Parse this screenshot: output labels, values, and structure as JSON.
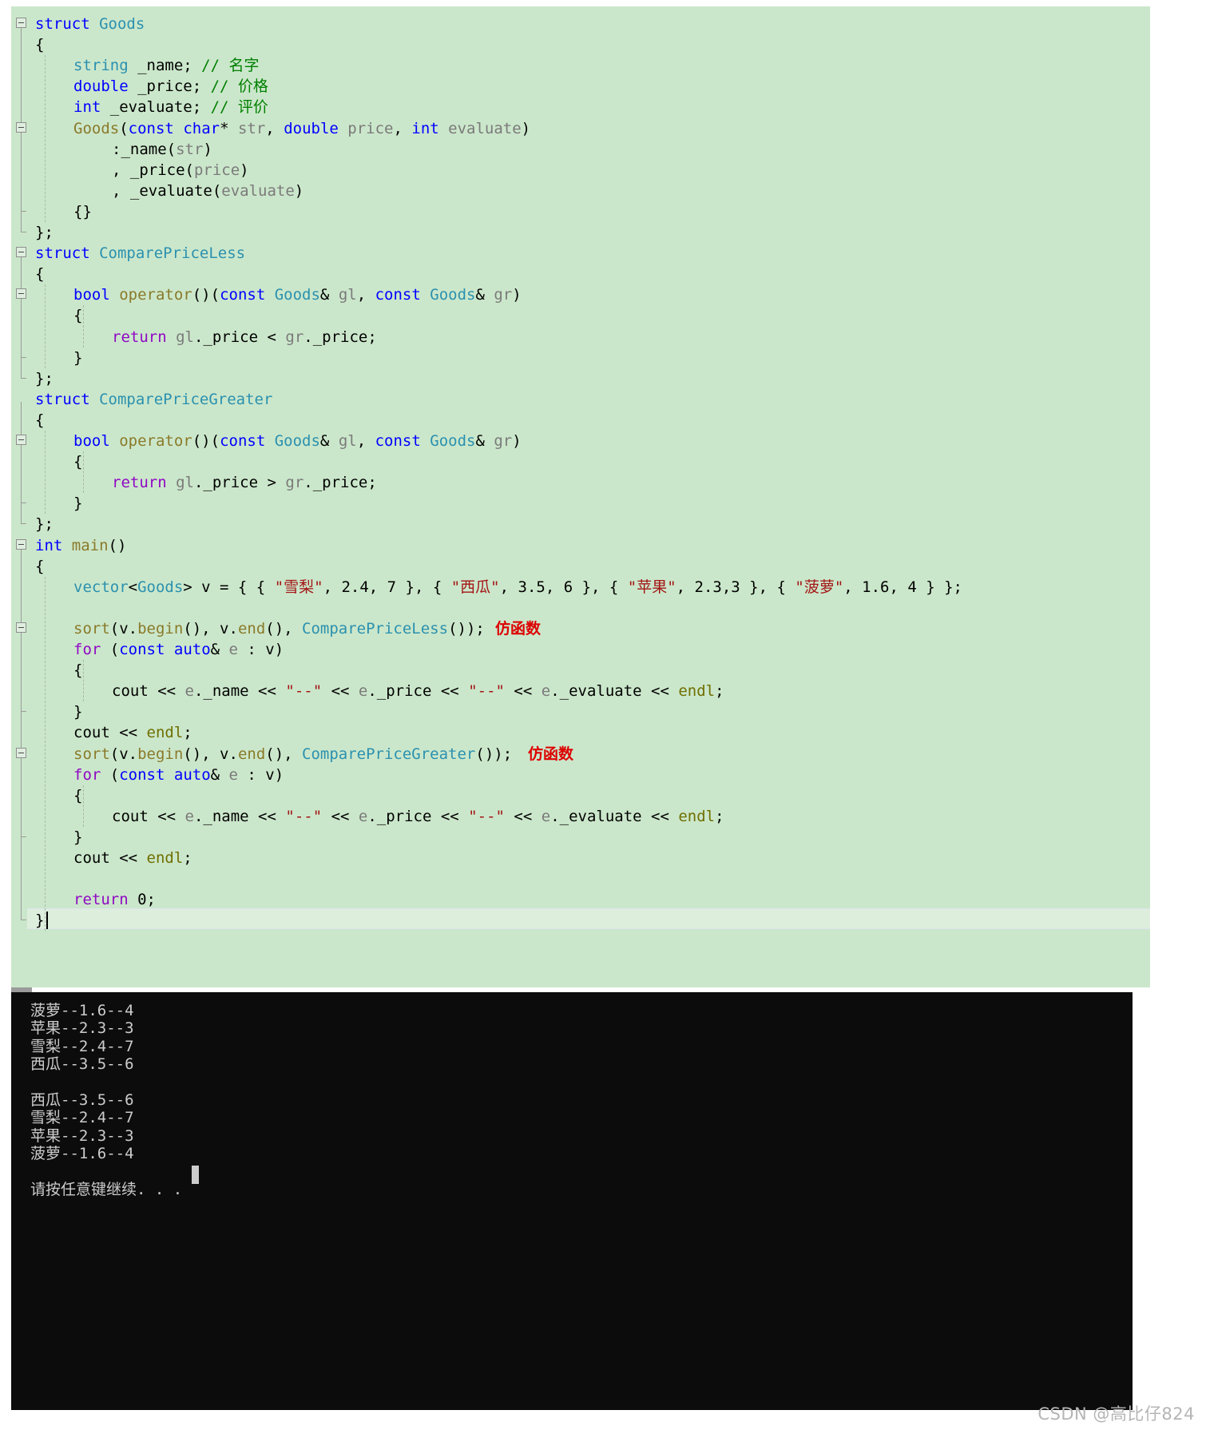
{
  "editor": {
    "background_color": "#cbe7cb",
    "current_line_color": "#ddeedd",
    "lines": [
      {
        "indent": 0,
        "tokens": [
          {
            "t": "struct ",
            "c": "kw"
          },
          {
            "t": "Goods",
            "c": "type"
          }
        ]
      },
      {
        "indent": 0,
        "tokens": [
          {
            "t": "{",
            "c": "plain"
          }
        ]
      },
      {
        "indent": 1,
        "tokens": [
          {
            "t": "string",
            "c": "type"
          },
          {
            "t": " _name; ",
            "c": "plain"
          },
          {
            "t": "// 名字",
            "c": "cmt"
          }
        ]
      },
      {
        "indent": 1,
        "tokens": [
          {
            "t": "double",
            "c": "kw"
          },
          {
            "t": " _price; ",
            "c": "plain"
          },
          {
            "t": "// 价格",
            "c": "cmt"
          }
        ]
      },
      {
        "indent": 1,
        "tokens": [
          {
            "t": "int",
            "c": "kw"
          },
          {
            "t": " _evaluate; ",
            "c": "plain"
          },
          {
            "t": "// 评价",
            "c": "cmt"
          }
        ]
      },
      {
        "indent": 1,
        "tokens": [
          {
            "t": "Goods",
            "c": "func"
          },
          {
            "t": "(",
            "c": "plain"
          },
          {
            "t": "const",
            "c": "kw"
          },
          {
            "t": " ",
            "c": "plain"
          },
          {
            "t": "char",
            "c": "kw"
          },
          {
            "t": "* ",
            "c": "plain"
          },
          {
            "t": "str",
            "c": "ident"
          },
          {
            "t": ", ",
            "c": "plain"
          },
          {
            "t": "double",
            "c": "kw"
          },
          {
            "t": " ",
            "c": "plain"
          },
          {
            "t": "price",
            "c": "ident"
          },
          {
            "t": ", ",
            "c": "plain"
          },
          {
            "t": "int",
            "c": "kw"
          },
          {
            "t": " ",
            "c": "plain"
          },
          {
            "t": "evaluate",
            "c": "ident"
          },
          {
            "t": ")",
            "c": "plain"
          }
        ]
      },
      {
        "indent": 2,
        "tokens": [
          {
            "t": ":_name(",
            "c": "plain"
          },
          {
            "t": "str",
            "c": "ident"
          },
          {
            "t": ")",
            "c": "plain"
          }
        ]
      },
      {
        "indent": 2,
        "tokens": [
          {
            "t": ", _price(",
            "c": "plain"
          },
          {
            "t": "price",
            "c": "ident"
          },
          {
            "t": ")",
            "c": "plain"
          }
        ]
      },
      {
        "indent": 2,
        "tokens": [
          {
            "t": ", _evaluate(",
            "c": "plain"
          },
          {
            "t": "evaluate",
            "c": "ident"
          },
          {
            "t": ")",
            "c": "plain"
          }
        ]
      },
      {
        "indent": 1,
        "tokens": [
          {
            "t": "{}",
            "c": "plain"
          }
        ]
      },
      {
        "indent": 0,
        "tokens": [
          {
            "t": "};",
            "c": "plain"
          }
        ]
      },
      {
        "indent": 0,
        "tokens": [
          {
            "t": "struct ",
            "c": "kw"
          },
          {
            "t": "ComparePriceLess",
            "c": "type"
          }
        ]
      },
      {
        "indent": 0,
        "tokens": [
          {
            "t": "{",
            "c": "plain"
          }
        ]
      },
      {
        "indent": 1,
        "tokens": [
          {
            "t": "bool",
            "c": "kw"
          },
          {
            "t": " ",
            "c": "plain"
          },
          {
            "t": "operator",
            "c": "func"
          },
          {
            "t": "()(",
            "c": "plain"
          },
          {
            "t": "const",
            "c": "kw"
          },
          {
            "t": " ",
            "c": "plain"
          },
          {
            "t": "Goods",
            "c": "type"
          },
          {
            "t": "& ",
            "c": "plain"
          },
          {
            "t": "gl",
            "c": "ident"
          },
          {
            "t": ", ",
            "c": "plain"
          },
          {
            "t": "const",
            "c": "kw"
          },
          {
            "t": " ",
            "c": "plain"
          },
          {
            "t": "Goods",
            "c": "type"
          },
          {
            "t": "& ",
            "c": "plain"
          },
          {
            "t": "gr",
            "c": "ident"
          },
          {
            "t": ")",
            "c": "plain"
          }
        ]
      },
      {
        "indent": 1,
        "tokens": [
          {
            "t": "{",
            "c": "plain"
          }
        ]
      },
      {
        "indent": 2,
        "tokens": [
          {
            "t": "return",
            "c": "ctrl"
          },
          {
            "t": " ",
            "c": "plain"
          },
          {
            "t": "gl",
            "c": "ident"
          },
          {
            "t": "._price < ",
            "c": "plain"
          },
          {
            "t": "gr",
            "c": "ident"
          },
          {
            "t": "._price;",
            "c": "plain"
          }
        ]
      },
      {
        "indent": 1,
        "tokens": [
          {
            "t": "}",
            "c": "plain"
          }
        ]
      },
      {
        "indent": 0,
        "tokens": [
          {
            "t": "};",
            "c": "plain"
          }
        ]
      },
      {
        "indent": 0,
        "tokens": [
          {
            "t": "struct ",
            "c": "kw"
          },
          {
            "t": "ComparePriceGreater",
            "c": "type"
          }
        ]
      },
      {
        "indent": 0,
        "tokens": [
          {
            "t": "{",
            "c": "plain"
          }
        ]
      },
      {
        "indent": 1,
        "tokens": [
          {
            "t": "bool",
            "c": "kw"
          },
          {
            "t": " ",
            "c": "plain"
          },
          {
            "t": "operator",
            "c": "func"
          },
          {
            "t": "()(",
            "c": "plain"
          },
          {
            "t": "const",
            "c": "kw"
          },
          {
            "t": " ",
            "c": "plain"
          },
          {
            "t": "Goods",
            "c": "type"
          },
          {
            "t": "& ",
            "c": "plain"
          },
          {
            "t": "gl",
            "c": "ident"
          },
          {
            "t": ", ",
            "c": "plain"
          },
          {
            "t": "const",
            "c": "kw"
          },
          {
            "t": " ",
            "c": "plain"
          },
          {
            "t": "Goods",
            "c": "type"
          },
          {
            "t": "& ",
            "c": "plain"
          },
          {
            "t": "gr",
            "c": "ident"
          },
          {
            "t": ")",
            "c": "plain"
          }
        ]
      },
      {
        "indent": 1,
        "tokens": [
          {
            "t": "{",
            "c": "plain"
          }
        ]
      },
      {
        "indent": 2,
        "tokens": [
          {
            "t": "return",
            "c": "ctrl"
          },
          {
            "t": " ",
            "c": "plain"
          },
          {
            "t": "gl",
            "c": "ident"
          },
          {
            "t": "._price > ",
            "c": "plain"
          },
          {
            "t": "gr",
            "c": "ident"
          },
          {
            "t": "._price;",
            "c": "plain"
          }
        ]
      },
      {
        "indent": 1,
        "tokens": [
          {
            "t": "}",
            "c": "plain"
          }
        ]
      },
      {
        "indent": 0,
        "tokens": [
          {
            "t": "};",
            "c": "plain"
          }
        ]
      },
      {
        "indent": 0,
        "tokens": [
          {
            "t": "int",
            "c": "kw"
          },
          {
            "t": " ",
            "c": "plain"
          },
          {
            "t": "main",
            "c": "func"
          },
          {
            "t": "()",
            "c": "plain"
          }
        ]
      },
      {
        "indent": 0,
        "tokens": [
          {
            "t": "{",
            "c": "plain"
          }
        ]
      },
      {
        "indent": 1,
        "tokens": [
          {
            "t": "vector",
            "c": "type"
          },
          {
            "t": "<",
            "c": "plain"
          },
          {
            "t": "Goods",
            "c": "type"
          },
          {
            "t": "> v = { { ",
            "c": "plain"
          },
          {
            "t": "\"雪梨\"",
            "c": "str"
          },
          {
            "t": ", 2.4, 7 }, { ",
            "c": "plain"
          },
          {
            "t": "\"西瓜\"",
            "c": "str"
          },
          {
            "t": ", 3.5, 6 }, { ",
            "c": "plain"
          },
          {
            "t": "\"苹果\"",
            "c": "str"
          },
          {
            "t": ", 2.3,3 }, { ",
            "c": "plain"
          },
          {
            "t": "\"菠萝\"",
            "c": "str"
          },
          {
            "t": ", 1.6, 4 } };",
            "c": "plain"
          }
        ]
      },
      {
        "indent": 1,
        "tokens": []
      },
      {
        "indent": 1,
        "tokens": [
          {
            "t": "sort",
            "c": "func"
          },
          {
            "t": "(v.",
            "c": "plain"
          },
          {
            "t": "begin",
            "c": "func"
          },
          {
            "t": "(), v.",
            "c": "plain"
          },
          {
            "t": "end",
            "c": "func"
          },
          {
            "t": "(), ",
            "c": "plain"
          },
          {
            "t": "ComparePriceLess",
            "c": "type"
          },
          {
            "t": "());",
            "c": "plain"
          },
          {
            "t": "  仿函数",
            "c": "note"
          }
        ]
      },
      {
        "indent": 1,
        "tokens": [
          {
            "t": "for",
            "c": "ctrl"
          },
          {
            "t": " (",
            "c": "plain"
          },
          {
            "t": "const",
            "c": "kw"
          },
          {
            "t": " ",
            "c": "plain"
          },
          {
            "t": "auto",
            "c": "kw"
          },
          {
            "t": "& ",
            "c": "plain"
          },
          {
            "t": "e",
            "c": "ident"
          },
          {
            "t": " : v)",
            "c": "plain"
          }
        ]
      },
      {
        "indent": 1,
        "tokens": [
          {
            "t": "{",
            "c": "plain"
          }
        ]
      },
      {
        "indent": 2,
        "tokens": [
          {
            "t": "cout",
            "c": "plain"
          },
          {
            "t": " << ",
            "c": "plain"
          },
          {
            "t": "e",
            "c": "ident"
          },
          {
            "t": "._name << ",
            "c": "plain"
          },
          {
            "t": "\"--\"",
            "c": "str"
          },
          {
            "t": " << ",
            "c": "plain"
          },
          {
            "t": "e",
            "c": "ident"
          },
          {
            "t": "._price << ",
            "c": "plain"
          },
          {
            "t": "\"--\"",
            "c": "str"
          },
          {
            "t": " << ",
            "c": "plain"
          },
          {
            "t": "e",
            "c": "ident"
          },
          {
            "t": "._evaluate << ",
            "c": "plain"
          },
          {
            "t": "endl",
            "c": "member"
          },
          {
            "t": ";",
            "c": "plain"
          }
        ]
      },
      {
        "indent": 1,
        "tokens": [
          {
            "t": "}",
            "c": "plain"
          }
        ]
      },
      {
        "indent": 1,
        "tokens": [
          {
            "t": "cout",
            "c": "plain"
          },
          {
            "t": " << ",
            "c": "plain"
          },
          {
            "t": "endl",
            "c": "member"
          },
          {
            "t": ";",
            "c": "plain"
          }
        ]
      },
      {
        "indent": 1,
        "tokens": [
          {
            "t": "sort",
            "c": "func"
          },
          {
            "t": "(v.",
            "c": "plain"
          },
          {
            "t": "begin",
            "c": "func"
          },
          {
            "t": "(), v.",
            "c": "plain"
          },
          {
            "t": "end",
            "c": "func"
          },
          {
            "t": "(), ",
            "c": "plain"
          },
          {
            "t": "ComparePriceGreater",
            "c": "type"
          },
          {
            "t": "());",
            "c": "plain"
          },
          {
            "t": "   仿函数",
            "c": "note"
          }
        ]
      },
      {
        "indent": 1,
        "tokens": [
          {
            "t": "for",
            "c": "ctrl"
          },
          {
            "t": " (",
            "c": "plain"
          },
          {
            "t": "const",
            "c": "kw"
          },
          {
            "t": " ",
            "c": "plain"
          },
          {
            "t": "auto",
            "c": "kw"
          },
          {
            "t": "& ",
            "c": "plain"
          },
          {
            "t": "e",
            "c": "ident"
          },
          {
            "t": " : v)",
            "c": "plain"
          }
        ]
      },
      {
        "indent": 1,
        "tokens": [
          {
            "t": "{",
            "c": "plain"
          }
        ]
      },
      {
        "indent": 2,
        "tokens": [
          {
            "t": "cout",
            "c": "plain"
          },
          {
            "t": " << ",
            "c": "plain"
          },
          {
            "t": "e",
            "c": "ident"
          },
          {
            "t": "._name << ",
            "c": "plain"
          },
          {
            "t": "\"--\"",
            "c": "str"
          },
          {
            "t": " << ",
            "c": "plain"
          },
          {
            "t": "e",
            "c": "ident"
          },
          {
            "t": "._price << ",
            "c": "plain"
          },
          {
            "t": "\"--\"",
            "c": "str"
          },
          {
            "t": " << ",
            "c": "plain"
          },
          {
            "t": "e",
            "c": "ident"
          },
          {
            "t": "._evaluate << ",
            "c": "plain"
          },
          {
            "t": "endl",
            "c": "member"
          },
          {
            "t": ";",
            "c": "plain"
          }
        ]
      },
      {
        "indent": 1,
        "tokens": [
          {
            "t": "}",
            "c": "plain"
          }
        ]
      },
      {
        "indent": 1,
        "tokens": [
          {
            "t": "cout",
            "c": "plain"
          },
          {
            "t": " << ",
            "c": "plain"
          },
          {
            "t": "endl",
            "c": "member"
          },
          {
            "t": ";",
            "c": "plain"
          }
        ]
      },
      {
        "indent": 1,
        "tokens": []
      },
      {
        "indent": 1,
        "tokens": [
          {
            "t": "return",
            "c": "ctrl"
          },
          {
            "t": " ",
            "c": "plain"
          },
          {
            "t": "0",
            "c": "num"
          },
          {
            "t": ";",
            "c": "plain"
          }
        ]
      },
      {
        "indent": 0,
        "tokens": [
          {
            "t": "}",
            "c": "plain"
          }
        ]
      }
    ],
    "fold_boxes": [
      {
        "line": 0
      },
      {
        "line": 5
      },
      {
        "line": 11
      },
      {
        "line": 13
      },
      {
        "line": 20
      },
      {
        "line": 25
      },
      {
        "line": 29
      },
      {
        "line": 35
      }
    ],
    "annotations": [
      {
        "label": "仿函数",
        "meaning": "functor",
        "color": "#dd0000"
      },
      {
        "label": "仿函数",
        "meaning": "functor",
        "color": "#dd0000"
      }
    ],
    "caret_line": 43
  },
  "console": {
    "background_color": "#0c0c0c",
    "text_color": "#cccccc",
    "lines": [
      "菠萝--1.6--4",
      "苹果--2.3--3",
      "雪梨--2.4--7",
      "西瓜--3.5--6",
      "",
      "西瓜--3.5--6",
      "雪梨--2.4--7",
      "苹果--2.3--3",
      "菠萝--1.6--4",
      "",
      "请按任意键继续. . ."
    ],
    "prompt": "请按任意键继续. . .",
    "sorted_ascending": [
      {
        "name": "菠萝",
        "price": "1.6",
        "evaluate": "4"
      },
      {
        "name": "苹果",
        "price": "2.3",
        "evaluate": "3"
      },
      {
        "name": "雪梨",
        "price": "2.4",
        "evaluate": "7"
      },
      {
        "name": "西瓜",
        "price": "3.5",
        "evaluate": "6"
      }
    ],
    "sorted_descending": [
      {
        "name": "西瓜",
        "price": "3.5",
        "evaluate": "6"
      },
      {
        "name": "雪梨",
        "price": "2.4",
        "evaluate": "7"
      },
      {
        "name": "苹果",
        "price": "2.3",
        "evaluate": "3"
      },
      {
        "name": "菠萝",
        "price": "1.6",
        "evaluate": "4"
      }
    ]
  },
  "watermark": {
    "text": "CSDN @高比仔824"
  }
}
